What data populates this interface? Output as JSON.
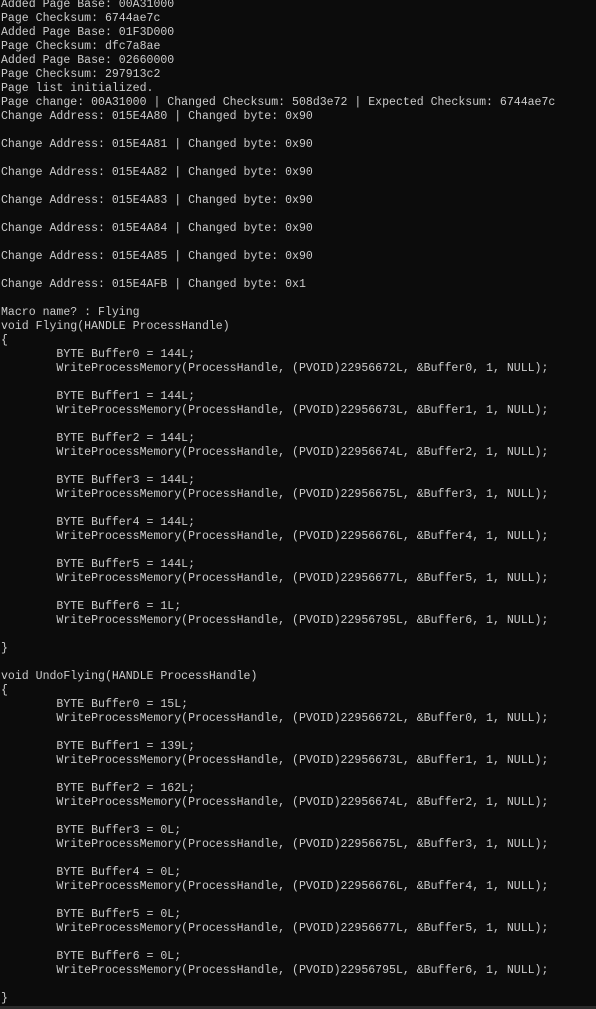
{
  "console": {
    "lines": [
      "Added Page Base: 00A31000",
      "Page Checksum: 6744ae7c",
      "Added Page Base: 01F3D000",
      "Page Checksum: dfc7a8ae",
      "Added Page Base: 02660000",
      "Page Checksum: 297913c2",
      "Page list initialized.",
      "Page change: 00A31000 | Changed Checksum: 508d3e72 | Expected Checksum: 6744ae7c",
      "Change Address: 015E4A80 | Changed byte: 0x90",
      "",
      "Change Address: 015E4A81 | Changed byte: 0x90",
      "",
      "Change Address: 015E4A82 | Changed byte: 0x90",
      "",
      "Change Address: 015E4A83 | Changed byte: 0x90",
      "",
      "Change Address: 015E4A84 | Changed byte: 0x90",
      "",
      "Change Address: 015E4A85 | Changed byte: 0x90",
      "",
      "Change Address: 015E4AFB | Changed byte: 0x1",
      "",
      "Macro name? : Flying",
      "void Flying(HANDLE ProcessHandle)",
      "{",
      "        BYTE Buffer0 = 144L;",
      "        WriteProcessMemory(ProcessHandle, (PVOID)22956672L, &Buffer0, 1, NULL);",
      "",
      "        BYTE Buffer1 = 144L;",
      "        WriteProcessMemory(ProcessHandle, (PVOID)22956673L, &Buffer1, 1, NULL);",
      "",
      "        BYTE Buffer2 = 144L;",
      "        WriteProcessMemory(ProcessHandle, (PVOID)22956674L, &Buffer2, 1, NULL);",
      "",
      "        BYTE Buffer3 = 144L;",
      "        WriteProcessMemory(ProcessHandle, (PVOID)22956675L, &Buffer3, 1, NULL);",
      "",
      "        BYTE Buffer4 = 144L;",
      "        WriteProcessMemory(ProcessHandle, (PVOID)22956676L, &Buffer4, 1, NULL);",
      "",
      "        BYTE Buffer5 = 144L;",
      "        WriteProcessMemory(ProcessHandle, (PVOID)22956677L, &Buffer5, 1, NULL);",
      "",
      "        BYTE Buffer6 = 1L;",
      "        WriteProcessMemory(ProcessHandle, (PVOID)22956795L, &Buffer6, 1, NULL);",
      "",
      "}",
      "",
      "void UndoFlying(HANDLE ProcessHandle)",
      "{",
      "        BYTE Buffer0 = 15L;",
      "        WriteProcessMemory(ProcessHandle, (PVOID)22956672L, &Buffer0, 1, NULL);",
      "",
      "        BYTE Buffer1 = 139L;",
      "        WriteProcessMemory(ProcessHandle, (PVOID)22956673L, &Buffer1, 1, NULL);",
      "",
      "        BYTE Buffer2 = 162L;",
      "        WriteProcessMemory(ProcessHandle, (PVOID)22956674L, &Buffer2, 1, NULL);",
      "",
      "        BYTE Buffer3 = 0L;",
      "        WriteProcessMemory(ProcessHandle, (PVOID)22956675L, &Buffer3, 1, NULL);",
      "",
      "        BYTE Buffer4 = 0L;",
      "        WriteProcessMemory(ProcessHandle, (PVOID)22956676L, &Buffer4, 1, NULL);",
      "",
      "        BYTE Buffer5 = 0L;",
      "        WriteProcessMemory(ProcessHandle, (PVOID)22956677L, &Buffer5, 1, NULL);",
      "",
      "        BYTE Buffer6 = 0L;",
      "        WriteProcessMemory(ProcessHandle, (PVOID)22956795L, &Buffer6, 1, NULL);",
      "",
      "}"
    ]
  },
  "colors": {
    "background": "#0c0c0c",
    "text": "#cccccc"
  }
}
